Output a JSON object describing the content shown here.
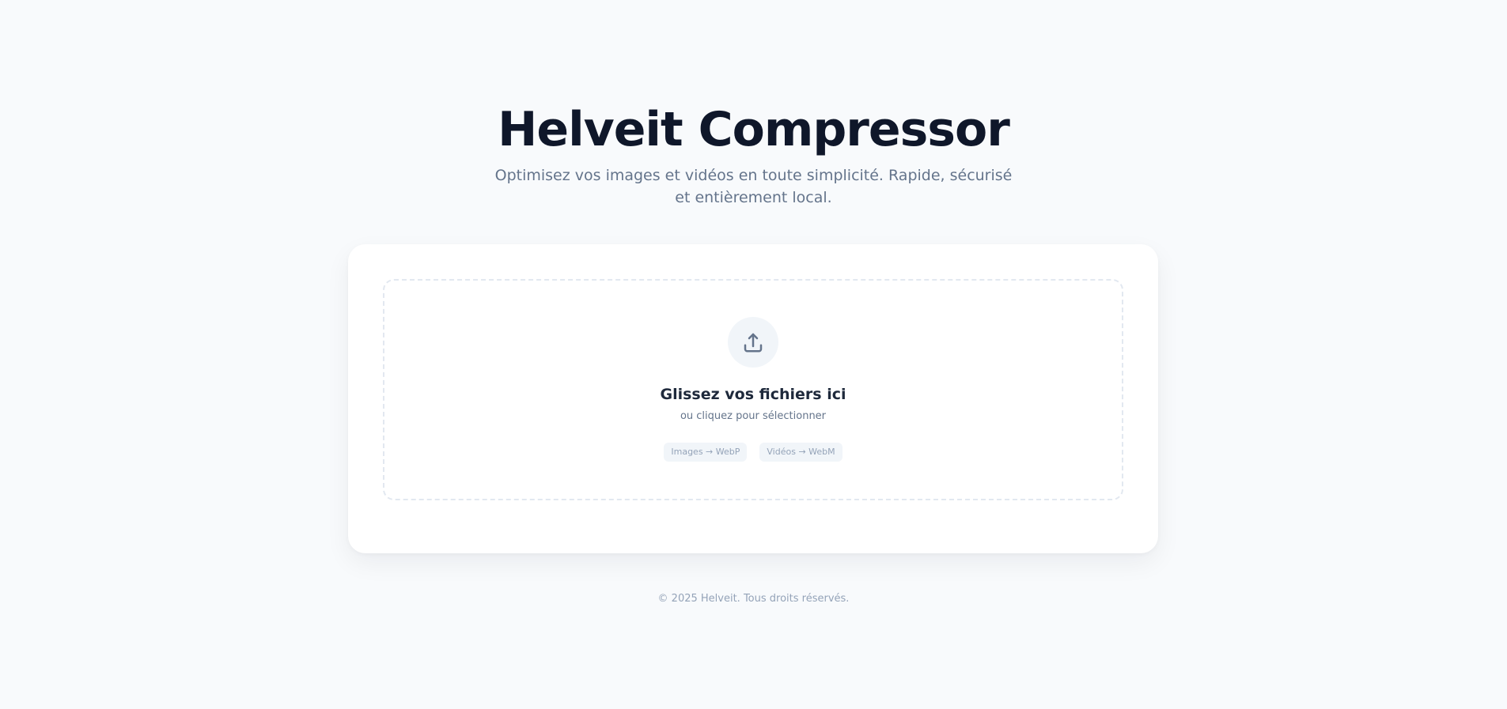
{
  "header": {
    "title": "Helveit Compressor",
    "subtitle": "Optimisez vos images et vidéos en toute simplicité. Rapide, sécurisé et entièrement local."
  },
  "dropzone": {
    "icon": "upload-icon",
    "title": "Glissez vos fichiers ici",
    "subtitle": "ou cliquez pour sélectionner",
    "tags": [
      "Images → WebP",
      "Vidéos → WebM"
    ]
  },
  "footer": {
    "text": "© 2025 Helveit. Tous droits réservés."
  },
  "colors": {
    "background": "#f8fafc",
    "title": "#0f172a",
    "muted": "#64748b",
    "icon": "#64748b"
  }
}
